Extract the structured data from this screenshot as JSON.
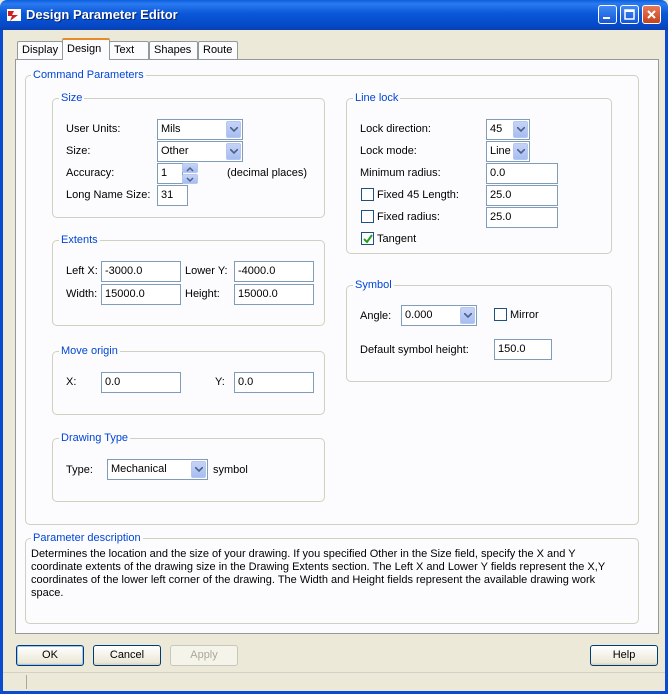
{
  "window": {
    "title": "Design Parameter Editor"
  },
  "tabs": [
    "Display",
    "Design",
    "Text",
    "Shapes",
    "Route"
  ],
  "groups": {
    "command_parameters": "Command Parameters",
    "size": "Size",
    "extents": "Extents",
    "move_origin": "Move origin",
    "drawing_type": "Drawing Type",
    "line_lock": "Line lock",
    "symbol": "Symbol",
    "parameter_description": "Parameter description"
  },
  "size": {
    "user_units_label": "User Units:",
    "user_units_value": "Mils",
    "size_label": "Size:",
    "size_value": "Other",
    "accuracy_label": "Accuracy:",
    "accuracy_value": "1",
    "accuracy_suffix": "(decimal places)",
    "long_name_label": "Long Name Size:",
    "long_name_value": "31"
  },
  "extents": {
    "left_x_label": "Left X:",
    "left_x_value": "-3000.0",
    "lower_y_label": "Lower Y:",
    "lower_y_value": "-4000.0",
    "width_label": "Width:",
    "width_value": "15000.0",
    "height_label": "Height:",
    "height_value": "15000.0"
  },
  "move_origin": {
    "x_label": "X:",
    "x_value": "0.0",
    "y_label": "Y:",
    "y_value": "0.0"
  },
  "drawing_type": {
    "type_label": "Type:",
    "type_value": "Mechanical",
    "suffix": "symbol"
  },
  "line_lock": {
    "lock_direction_label": "Lock direction:",
    "lock_direction_value": "45",
    "lock_mode_label": "Lock mode:",
    "lock_mode_value": "Line",
    "min_radius_label": "Minimum radius:",
    "min_radius_value": "0.0",
    "fixed45_label": "Fixed 45 Length:",
    "fixed45_value": "25.0",
    "fixed45_checked": false,
    "fixed_radius_label": "Fixed radius:",
    "fixed_radius_value": "25.0",
    "fixed_radius_checked": false,
    "tangent_label": "Tangent",
    "tangent_checked": true
  },
  "symbol": {
    "angle_label": "Angle:",
    "angle_value": "0.000",
    "mirror_label": "Mirror",
    "mirror_checked": false,
    "default_height_label": "Default symbol height:",
    "default_height_value": "150.0"
  },
  "description": "Determines the location and the size of your drawing.  If you specified Other in the Size field, specify the X and Y coordinate extents of the drawing size in the Drawing Extents section. The Left X and Lower Y fields represent the X,Y coordinates of the lower left corner of the drawing.  The Width and Height fields represent the available drawing work space.",
  "buttons": {
    "ok": "OK",
    "cancel": "Cancel",
    "apply": "Apply",
    "help": "Help"
  }
}
